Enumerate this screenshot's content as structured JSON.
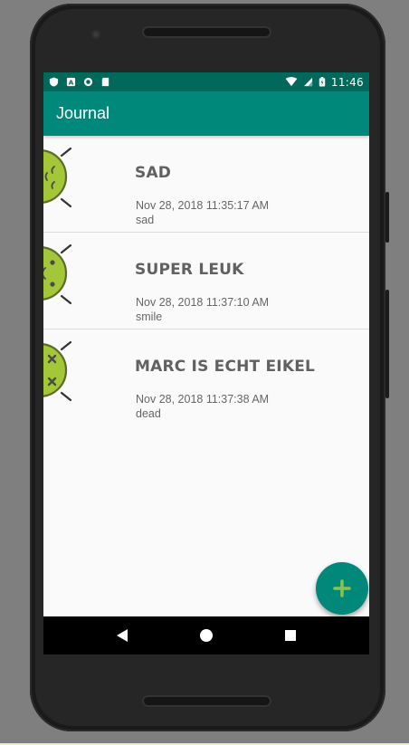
{
  "app": {
    "title": "Journal"
  },
  "status_bar": {
    "time": "11:46"
  },
  "entries": [
    {
      "title": "sad",
      "date": "Nov 28, 2018 11:35:17 AM",
      "mood": "sad",
      "icon": "sad-android-icon"
    },
    {
      "title": "super leuk",
      "date": "Nov 28, 2018 11:37:10 AM",
      "mood": "smile",
      "icon": "smile-android-icon"
    },
    {
      "title": "Marc is echt eikel",
      "date": "Nov 28, 2018 11:37:38 AM",
      "mood": "dead",
      "icon": "dead-android-icon"
    }
  ],
  "fab": {
    "icon": "add-icon"
  },
  "nav": {
    "back_icon": "back-icon",
    "home_icon": "home-icon",
    "recents_icon": "recents-icon"
  },
  "colors": {
    "primary": "#00897b",
    "primary_dark": "#00695c",
    "accent": "#8bc34a",
    "android_green": "#9ccc3a"
  }
}
